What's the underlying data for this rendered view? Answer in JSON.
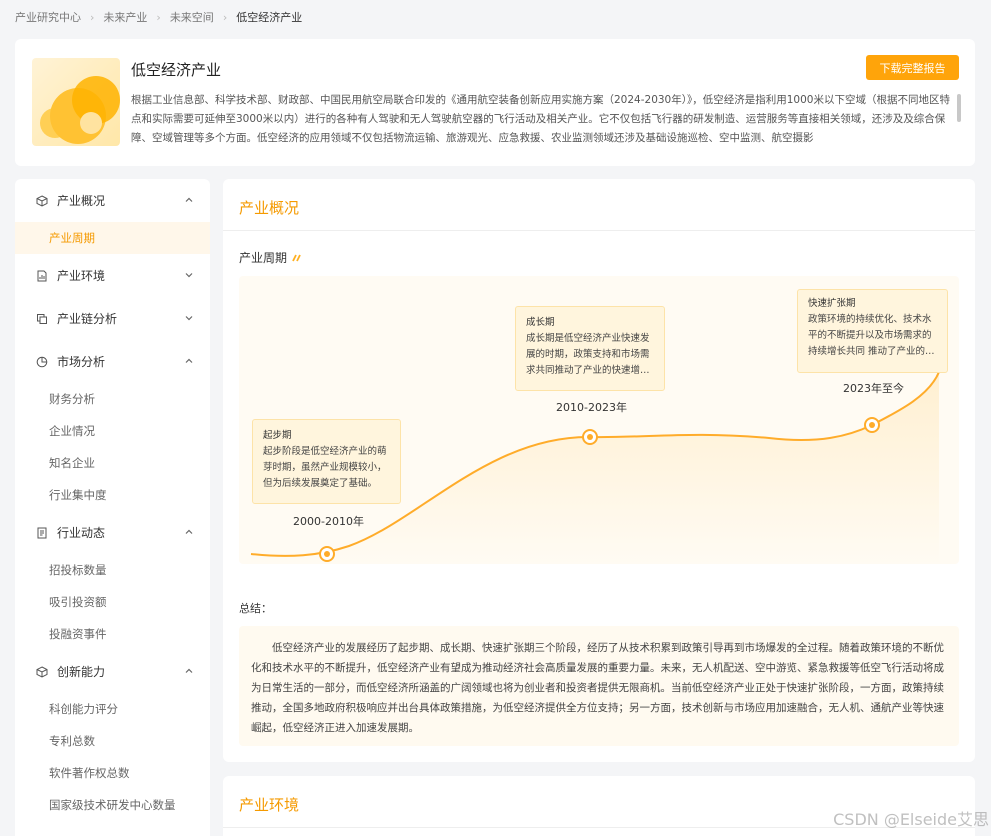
{
  "breadcrumb": {
    "items": [
      "产业研究中心",
      "未来产业",
      "未来空间"
    ],
    "current": "低空经济产业"
  },
  "header": {
    "title": "低空经济产业",
    "download_label": "下载完整报告",
    "description": "根据工业信息部、科学技术部、财政部、中国民用航空局联合印发的《通用航空装备创新应用实施方案（2024-2030年）》，低空经济是指利用1000米以下空域（根据不同地区特点和实际需要可延伸至3000米以内）进行的各种有人驾驶和无人驾驶航空器的飞行活动及相关产业。它不仅包括飞行器的研发制造、运营服务等直接相关领域，还涉及及综合保障、空域管理等多个方面。低空经济的应用领域不仅包括物流运输、旅游观光、应急救援、农业监测领域还涉及基础设施巡检、空中监测、航空摄影"
  },
  "sidebar": {
    "sections": [
      {
        "label": "产业概况",
        "icon": "cube-icon",
        "expanded": true,
        "items": [
          "产业周期"
        ]
      },
      {
        "label": "产业环境",
        "icon": "document-chart-icon",
        "expanded": false,
        "items": []
      },
      {
        "label": "产业链分析",
        "icon": "copy-icon",
        "expanded": false,
        "items": []
      },
      {
        "label": "市场分析",
        "icon": "pie-chart-icon",
        "expanded": true,
        "items": [
          "财务分析",
          "企业情况",
          "知名企业",
          "行业集中度"
        ]
      },
      {
        "label": "行业动态",
        "icon": "news-icon",
        "expanded": true,
        "items": [
          "招投标数量",
          "吸引投资额",
          "投融资事件"
        ]
      },
      {
        "label": "创新能力",
        "icon": "box-icon",
        "expanded": true,
        "items": [
          "科创能力评分",
          "专利总数",
          "软件著作权总数",
          "国家级技术研发中心数量"
        ]
      }
    ],
    "active_item": "产业周期"
  },
  "main": {
    "title": "产业概况",
    "subtitle": "产业周期",
    "stages": [
      {
        "name": "起步期",
        "text": "起步阶段是低空经济产业的萌芽时期，虽然产业规模较小，但为后续发展奠定了基础。",
        "date": "2000-2010年"
      },
      {
        "name": "成长期",
        "text": "成长期是低空经济产业快速发展的时期，政策支持和市场需求共同推动了产业的快速增…",
        "date": "2010-2023年"
      },
      {
        "name": "快速扩张期",
        "text": "政策环境的持续优化、技术水平的不断提升以及市场需求的持续增长共同 推动了产业的…",
        "date": "2023年至今"
      }
    ],
    "summary_label": "总结：",
    "summary": "低空经济产业的发展经历了起步期、成长期、快速扩张期三个阶段，经历了从技术积累到政策引导再到市场爆发的全过程。随着政策环境的不断优化和技术水平的不断提升，低空经济产业有望成为推动经济社会高质量发展的重要力量。未来，无人机配送、空中游览、紧急救援等低空飞行活动将成为日常生活的一部分，而低空经济所涵盖的广阔领域也将为创业者和投资者提供无限商机。当前低空经济产业正处于快速扩张阶段，一方面，政策持续推动，全国多地政府积极响应并出台具体政策措施，为低空经济提供全方位支持；另一方面，技术创新与市场应用加速融合，无人机、通航产业等快速崛起，低空经济正进入加速发展期。"
  },
  "card2": {
    "title": "产业环境"
  },
  "watermark": "CSDN @Elseide艾思",
  "colors": {
    "accent": "#ffa40a",
    "accent_text": "#f59a00",
    "active_bg": "#fff7ea"
  }
}
